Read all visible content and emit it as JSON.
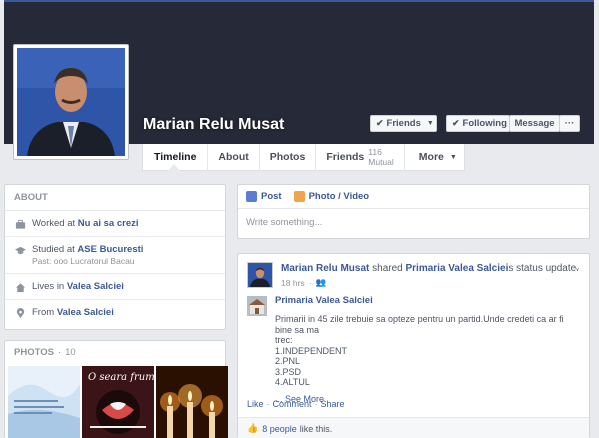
{
  "profile": {
    "name": "Marian Relu Musat",
    "buttons": {
      "friends": "Friends",
      "following": "Following",
      "message": "Message",
      "more": "···"
    }
  },
  "tabs": [
    {
      "label": "Timeline"
    },
    {
      "label": "About"
    },
    {
      "label": "Photos"
    },
    {
      "label": "Friends",
      "count": "116 Mutual"
    },
    {
      "label": "More"
    }
  ],
  "about": {
    "heading": "ABOUT",
    "items": [
      {
        "icon": "briefcase-icon",
        "prefix": "Worked at ",
        "value": "Nu ai sa crezi",
        "sub": ""
      },
      {
        "icon": "graduation-cap-icon",
        "prefix": "Studied at ",
        "value": "ASE Bucuresti",
        "sub": "Past: ooo Lucratorul Bacau"
      },
      {
        "icon": "home-icon",
        "prefix": "Lives in ",
        "value": "Valea Salciei",
        "sub": ""
      },
      {
        "icon": "map-pin-icon",
        "prefix": "From ",
        "value": "Valea Salciei",
        "sub": ""
      }
    ]
  },
  "photos": {
    "heading": "PHOTOS",
    "separator": "·",
    "count": "10",
    "thumb2_caption": "O seara frumoa"
  },
  "composer": {
    "post_label": "Post",
    "photo_label": "Photo / Video",
    "placeholder": "Write something..."
  },
  "post": {
    "author": "Marian Relu Musat",
    "verb": " shared ",
    "page": "Primaria Valea Salciei",
    "suffix": "s status update.",
    "time": "18 hrs",
    "shared_name": "Primaria Valea Salciei",
    "body_lines": [
      "Primarii in 45 zile trebuie sa opteze pentru un partid.Unde credeti ca ar fi bine sa ma",
      "trec:",
      "1.INDEPENDENT",
      "2.PNL",
      "3.PSD",
      "4.ALTUL"
    ],
    "see_more": "... See More",
    "actions": {
      "like": "Like",
      "comment": "Comment",
      "share": "Share",
      "sep": "·"
    },
    "likes_count": "8 people",
    "likes_suffix": "like this."
  },
  "colors": {
    "brand": "#3b5998",
    "cover": "#262a38",
    "page_bg": "#e9eaed"
  }
}
